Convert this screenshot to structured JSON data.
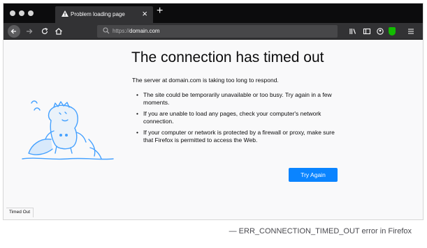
{
  "browser": {
    "tab_title": "Problem loading page",
    "tab_close": "×",
    "new_tab": "+",
    "url_prefix": "https://",
    "url_host": "domain.com",
    "icons": [
      "back-icon",
      "forward-icon",
      "reload-icon",
      "home-icon",
      "search-icon",
      "library-icon",
      "sidebar-icon",
      "account-icon",
      "shield-icon",
      "menu-icon"
    ]
  },
  "error": {
    "title": "The connection has timed out",
    "description": "The server at domain.com is taking too long to respond.",
    "reasons": [
      "The site could be temporarily unavailable or too busy. Try again in a few moments.",
      "If you are unable to load any pages, check your computer's network connection.",
      "If your computer or network is protected by a firewall or proxy, make sure that Firefox is permitted to access the Web."
    ],
    "button_label": "Try Again"
  },
  "status_text": "Timed Out",
  "caption": "— ERR_CONNECTION_TIMED_OUT error in Firefox",
  "colors": {
    "accent": "#0a84ff",
    "tabbar": "#0c0c0d",
    "toolbar": "#323234",
    "illustration": "#45a1ff"
  }
}
